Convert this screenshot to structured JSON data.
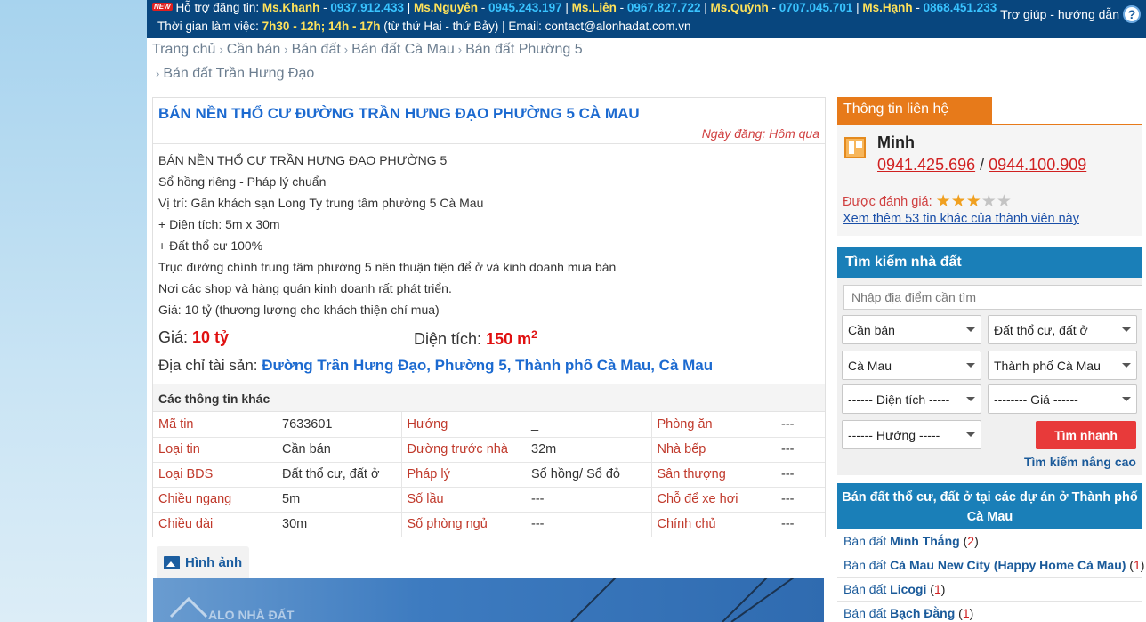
{
  "topbar": {
    "new_badge": "NEW",
    "support_label": "Hỗ trợ đăng tin:",
    "contacts": [
      {
        "name": "Ms.Khanh",
        "phone": "0937.912.433"
      },
      {
        "name": "Ms.Nguyên",
        "phone": "0945.243.197"
      },
      {
        "name": "Ms.Liên",
        "phone": "0967.827.722"
      },
      {
        "name": "Ms.Quỳnh",
        "phone": "0707.045.701"
      },
      {
        "name": "Ms.Hạnh",
        "phone": "0868.451.233"
      }
    ],
    "hours_label": "Thời gian làm việc:",
    "hours": "7h30 - 12h; 14h - 17h",
    "hours_note": "(từ thứ Hai - thứ Bảy) | Email: contact@alonhadat.com.vn",
    "help_label": "Trợ giúp - hướng dẫn",
    "help_icon": "?"
  },
  "breadcrumb": [
    "Trang chủ",
    "Cần bán",
    "Bán đất",
    "Bán đất Cà Mau",
    "Bán đất Phường 5",
    "Bán đất Trần Hưng Đạo"
  ],
  "listing": {
    "title": "BÁN NỀN THỔ CƯ ĐƯỜNG TRẦN HƯNG ĐẠO PHƯỜNG 5 CÀ MAU",
    "posted": "Ngày đăng: Hôm qua",
    "description": [
      "BÁN NỀN THỔ CƯ TRẦN HƯNG ĐẠO PHƯỜNG 5",
      "Sổ hồng riêng - Pháp lý chuẩn",
      "Vị trí: Gần khách sạn Long Ty trung tâm phường 5 Cà Mau",
      "+ Diện tích: 5m x 30m",
      "+ Đất thổ cư 100%",
      "Trục đường chính trung tâm phường 5 nên thuận tiện để ở và kinh doanh mua bán",
      "Nơi các shop và hàng quán kinh doanh rất phát triển.",
      "Giá: 10 tỷ (thương lượng cho khách thiện chí mua)"
    ],
    "price_label": "Giá:",
    "price_value": "10 tỷ",
    "area_label": "Diện tích:",
    "area_value": "150 m",
    "area_sup": "2",
    "address_label": "Địa chỉ tài sản:",
    "address_value": "Đường Trần Hưng Đạo, Phường 5, Thành phố Cà Mau, Cà Mau",
    "other_info_title": "Các thông tin khác",
    "info_rows": [
      [
        "Mã tin",
        "7633601",
        "Hướng",
        "_",
        "Phòng ăn",
        "---"
      ],
      [
        "Loại tin",
        "Cần bán",
        "Đường trước nhà",
        "32m",
        "Nhà bếp",
        "---"
      ],
      [
        "Loại BDS",
        "Đất thổ cư, đất ở",
        "Pháp lý",
        "Sổ hồng/ Sổ đỏ",
        "Sân thượng",
        "---"
      ],
      [
        "Chiều ngang",
        "5m",
        "Số lầu",
        "---",
        "Chỗ để xe hơi",
        "---"
      ],
      [
        "Chiều dài",
        "30m",
        "Số phòng ngủ",
        "---",
        "Chính chủ",
        "---"
      ]
    ],
    "images_tab": "Hình ảnh",
    "image_watermark": "ALO NHÀ ĐẤT"
  },
  "contact": {
    "tab": "Thông tin liên hệ",
    "name": "Minh",
    "phone1": "0941.425.696",
    "phone_sep": " / ",
    "phone2": "0944.100.909",
    "rating_label": "Được đánh giá:",
    "rating": 3,
    "rating_max": 5,
    "more_link": "Xem thêm 53 tin khác của thành viên này"
  },
  "search": {
    "title": "Tìm kiếm nhà đất",
    "placeholder": "Nhập địa điểm cần tìm",
    "selects": {
      "type": "Cần bán",
      "category": "Đất thổ cư, đất ở",
      "province": "Cà Mau",
      "district": "Thành phố Cà Mau",
      "area": "------ Diện tích -----",
      "price": "-------- Giá ------",
      "direction": "------ Hướng -----"
    },
    "button": "Tìm nhanh",
    "advanced": "Tìm kiếm nâng cao"
  },
  "projects": {
    "title": "Bán đất thổ cư, đất ở tại các dự án ở Thành phố Cà Mau",
    "prefix": "Bán đất",
    "items": [
      {
        "name": "Minh Thắng",
        "count": "2"
      },
      {
        "name": "Cà Mau New City (Happy Home Cà Mau)",
        "count": "1"
      },
      {
        "name": "Licogi",
        "count": "1"
      },
      {
        "name": "Bạch Đằng",
        "count": "1"
      }
    ]
  }
}
